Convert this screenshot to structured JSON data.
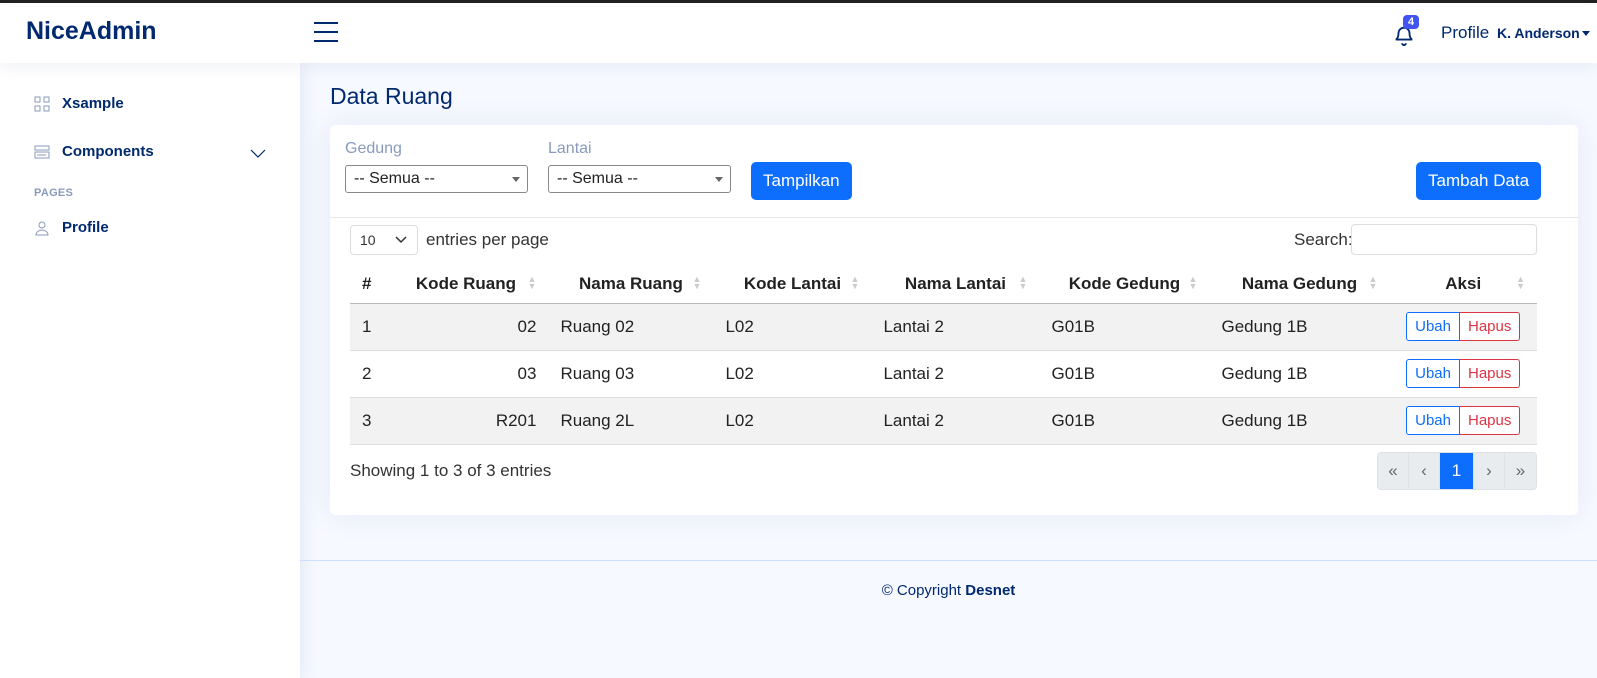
{
  "app": {
    "logo": "NiceAdmin"
  },
  "header": {
    "notifications_count": "4",
    "profile_label": "Profile",
    "profile_name": "K. Anderson"
  },
  "sidebar": {
    "items": [
      {
        "label": "Xsample",
        "icon": "grid-icon"
      },
      {
        "label": "Components",
        "icon": "menu-button-icon"
      }
    ],
    "section_heading": "PAGES",
    "pages": [
      {
        "label": "Profile",
        "icon": "person-icon"
      }
    ]
  },
  "page": {
    "title": "Data Ruang",
    "filters": {
      "gedung_label": "Gedung",
      "gedung_value": "-- Semua --",
      "lantai_label": "Lantai",
      "lantai_value": "-- Semua --",
      "show_button": "Tampilkan",
      "add_button": "Tambah Data"
    },
    "table_controls": {
      "per_page_value": "10",
      "per_page_label": "entries per page",
      "search_label": "Search:",
      "search_value": ""
    },
    "table": {
      "headers": [
        "#",
        "Kode Ruang",
        "Nama Ruang",
        "Kode Lantai",
        "Nama Lantai",
        "Kode Gedung",
        "Nama Gedung",
        "Aksi"
      ],
      "rows": [
        {
          "no": "1",
          "kode_ruang": "02",
          "nama_ruang": "Ruang 02",
          "kode_lantai": "L02",
          "nama_lantai": "Lantai 2",
          "kode_gedung": "G01B",
          "nama_gedung": "Gedung 1B"
        },
        {
          "no": "2",
          "kode_ruang": "03",
          "nama_ruang": "Ruang 03",
          "kode_lantai": "L02",
          "nama_lantai": "Lantai 2",
          "kode_gedung": "G01B",
          "nama_gedung": "Gedung 1B"
        },
        {
          "no": "3",
          "kode_ruang": "R201",
          "nama_ruang": "Ruang 2L",
          "kode_lantai": "L02",
          "nama_lantai": "Lantai 2",
          "kode_gedung": "G01B",
          "nama_gedung": "Gedung 1B"
        }
      ],
      "edit_label": "Ubah",
      "delete_label": "Hapus"
    },
    "pagination": {
      "summary": "Showing 1 to 3 of 3 entries",
      "first": "«",
      "prev": "‹",
      "current": "1",
      "next": "›",
      "last": "»"
    }
  },
  "footer": {
    "copyright": "© Copyright",
    "brand": "Desnet"
  },
  "colors": {
    "primary": "#0d6efd",
    "danger": "#dc3545",
    "navy": "#012970",
    "accent_badge": "#4154f1"
  }
}
